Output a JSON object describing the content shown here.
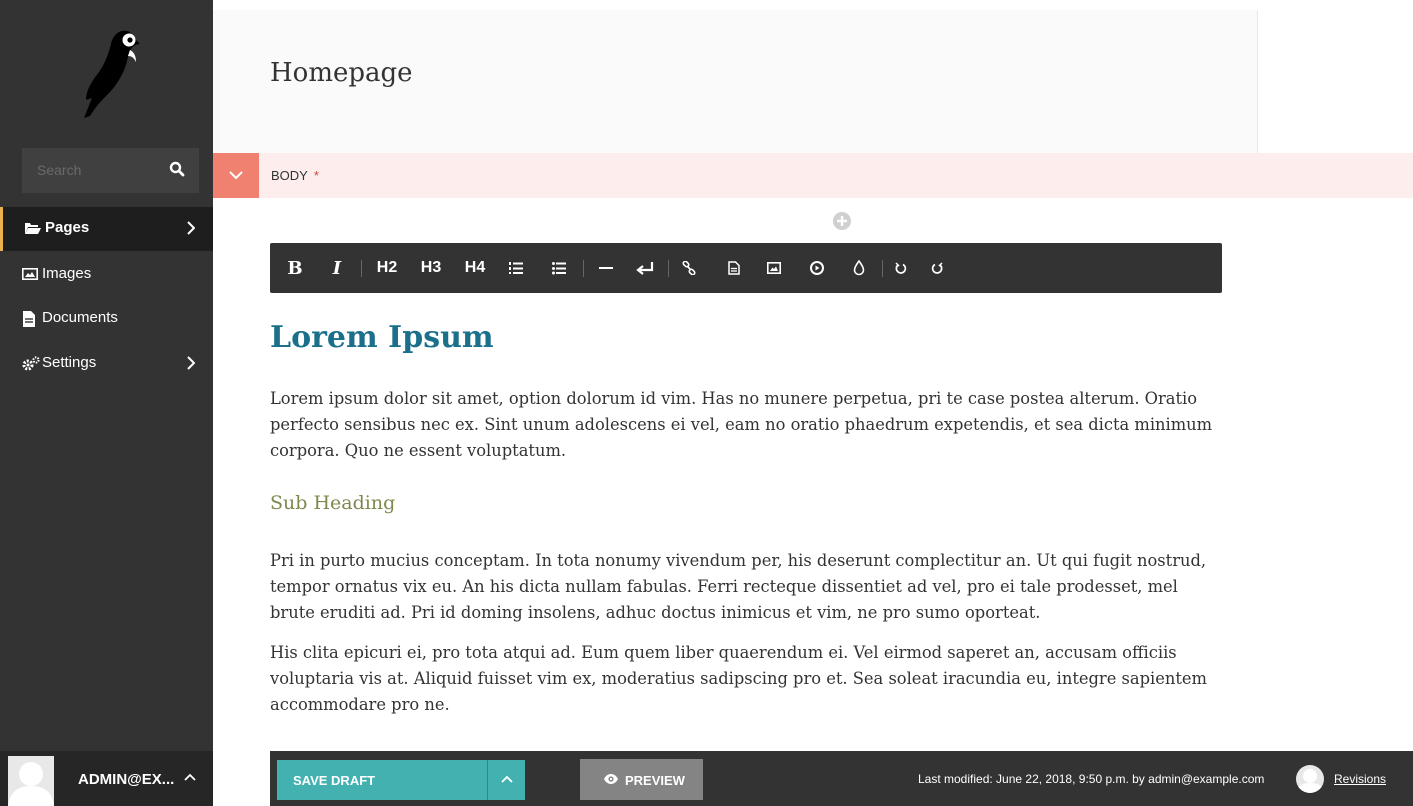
{
  "sidebar": {
    "search": {
      "placeholder": "Search"
    },
    "items": [
      {
        "label": "Pages",
        "icon": "folder-open-icon",
        "has_submenu": true,
        "active": true
      },
      {
        "label": "Images",
        "icon": "image-icon",
        "has_submenu": false
      },
      {
        "label": "Documents",
        "icon": "document-icon",
        "has_submenu": false
      },
      {
        "label": "Settings",
        "icon": "cogs-icon",
        "has_submenu": true
      }
    ],
    "account": {
      "label": "ADMIN@EX..."
    }
  },
  "header": {
    "title": "Homepage"
  },
  "field": {
    "label": "BODY",
    "required_mark": "*"
  },
  "toolbar": {
    "bold": "B",
    "italic": "I",
    "h2": "H2",
    "h3": "H3",
    "h4": "H4",
    "icons": [
      "ordered-list-icon",
      "bullet-list-icon",
      "horizontal-rule-icon",
      "line-break-icon",
      "link-icon",
      "document-link-icon",
      "image-icon",
      "embed-icon",
      "color-icon",
      "undo-icon",
      "redo-icon"
    ]
  },
  "content": {
    "heading": "Lorem Ipsum",
    "paragraph1": "Lorem ipsum dolor sit amet, option dolorum id vim. Has no munere perpetua, pri te case postea alterum. Oratio perfecto sensibus nec ex. Sint unum adolescens ei vel, eam no oratio phaedrum expetendis, et sea dicta minimum corpora. Quo ne essent voluptatum.",
    "subheading": "Sub Heading",
    "paragraph2": "Pri in purto mucius conceptam. In tota nonumy vivendum per, his deserunt complectitur an. Ut qui fugit nostrud, tempor ornatus vix eu. An his dicta nullam fabulas. Ferri recteque dissentiet ad vel, pro ei tale prodesset, mel brute eruditi ad. Pri id doming insolens, adhuc doctus inimicus et vim, ne pro sumo oporteat.",
    "paragraph3": "His clita epicuri ei, pro tota atqui ad. Eum quem liber quaerendum ei. Vel eirmod saperet an, accusam officiis voluptaria vis at. Aliquid fuisset vim ex, moderatius sadipscing pro et. Sea soleat iracundia eu, integre sapientem accommodare pro ne."
  },
  "footer": {
    "save_label": "SAVE DRAFT",
    "preview_label": "PREVIEW",
    "last_modified": "Last modified: June 22, 2018, 9:50 p.m. by admin@example.com",
    "revisions_label": "Revisions"
  },
  "colors": {
    "sidebar": "#333333",
    "accent_teal": "#43b1b0",
    "heading_blue": "#1a6f8a",
    "subheading_olive": "#7c8a4d",
    "field_error_bg": "#fdeeed",
    "field_error_accent": "#f08070"
  }
}
